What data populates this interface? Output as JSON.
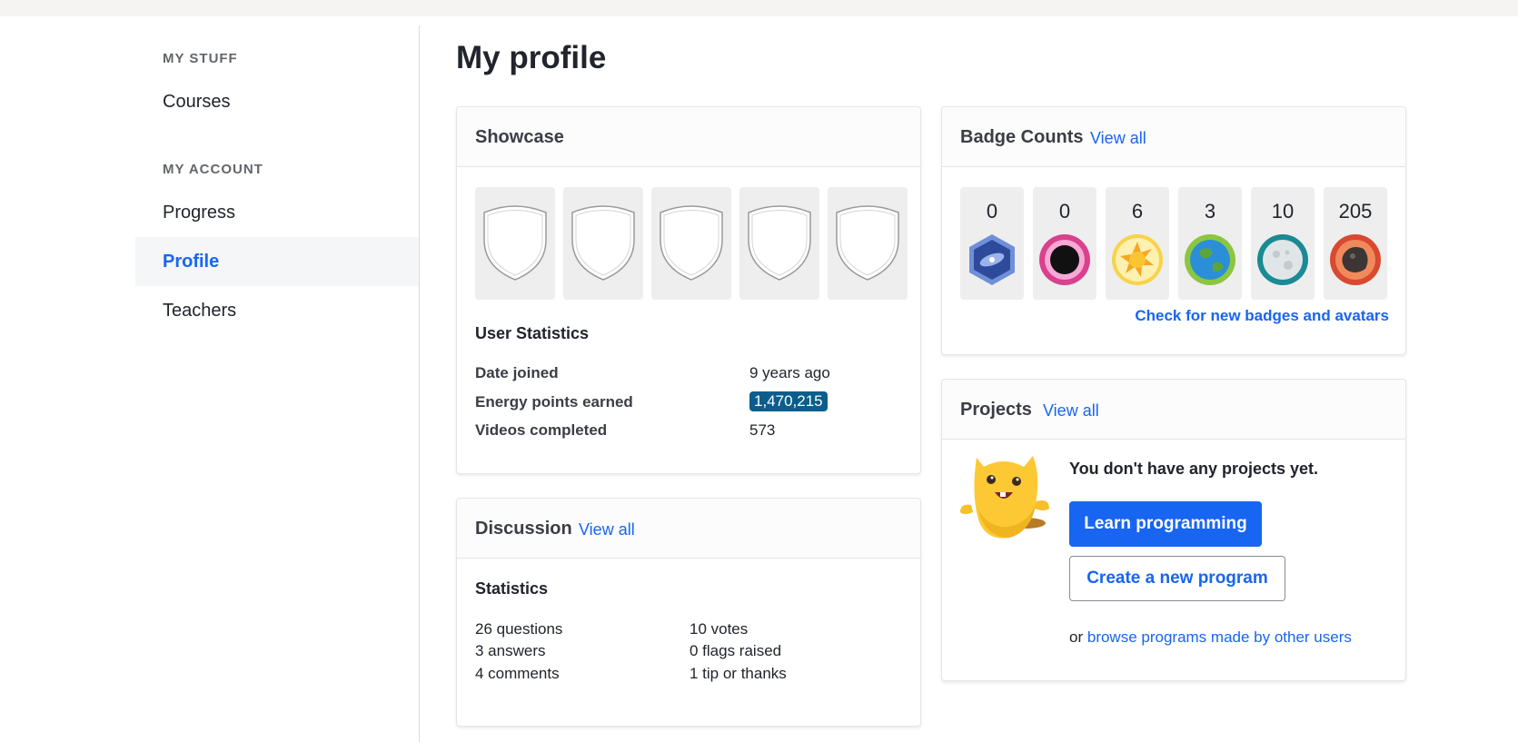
{
  "sidebar": {
    "sections": [
      {
        "heading": "MY STUFF",
        "items": [
          {
            "label": "Courses"
          }
        ]
      },
      {
        "heading": "MY ACCOUNT",
        "items": [
          {
            "label": "Progress"
          },
          {
            "label": "Profile",
            "active": true
          },
          {
            "label": "Teachers"
          }
        ]
      }
    ]
  },
  "page": {
    "title": "My profile"
  },
  "showcase": {
    "title": "Showcase",
    "slots": [
      "empty-badge-slot",
      "empty-badge-slot",
      "empty-badge-slot",
      "empty-badge-slot",
      "empty-badge-slot"
    ],
    "user_stats_title": "User Statistics",
    "stats": {
      "date_joined_label": "Date joined",
      "date_joined_value": "9 years ago",
      "energy_label": "Energy points earned",
      "energy_value": "1,470,215",
      "videos_label": "Videos completed",
      "videos_value": "573"
    }
  },
  "discussion": {
    "title": "Discussion",
    "view_all": "View all",
    "stats_title": "Statistics",
    "left": [
      "26 questions",
      "3 answers",
      "4 comments"
    ],
    "right": [
      "10 votes",
      "0 flags raised",
      "1 tip or thanks"
    ]
  },
  "badges": {
    "title": "Badge Counts",
    "view_all": "View all",
    "counts": [
      {
        "count": "0",
        "icon": "galaxy-badge-icon"
      },
      {
        "count": "0",
        "icon": "black-hole-badge-icon"
      },
      {
        "count": "6",
        "icon": "sun-badge-icon"
      },
      {
        "count": "3",
        "icon": "earth-badge-icon"
      },
      {
        "count": "10",
        "icon": "moon-badge-icon"
      },
      {
        "count": "205",
        "icon": "meteorite-badge-icon"
      }
    ],
    "check_link": "Check for new badges and avatars"
  },
  "projects": {
    "title": "Projects",
    "view_all": "View all",
    "empty_message": "You don't have any projects yet.",
    "learn_button": "Learn programming",
    "create_button": "Create a new program",
    "or_text": "or",
    "browse_link": "browse programs made by other users"
  },
  "colors": {
    "accent": "#1865f2",
    "energy_badge": "#0a5d8c"
  }
}
